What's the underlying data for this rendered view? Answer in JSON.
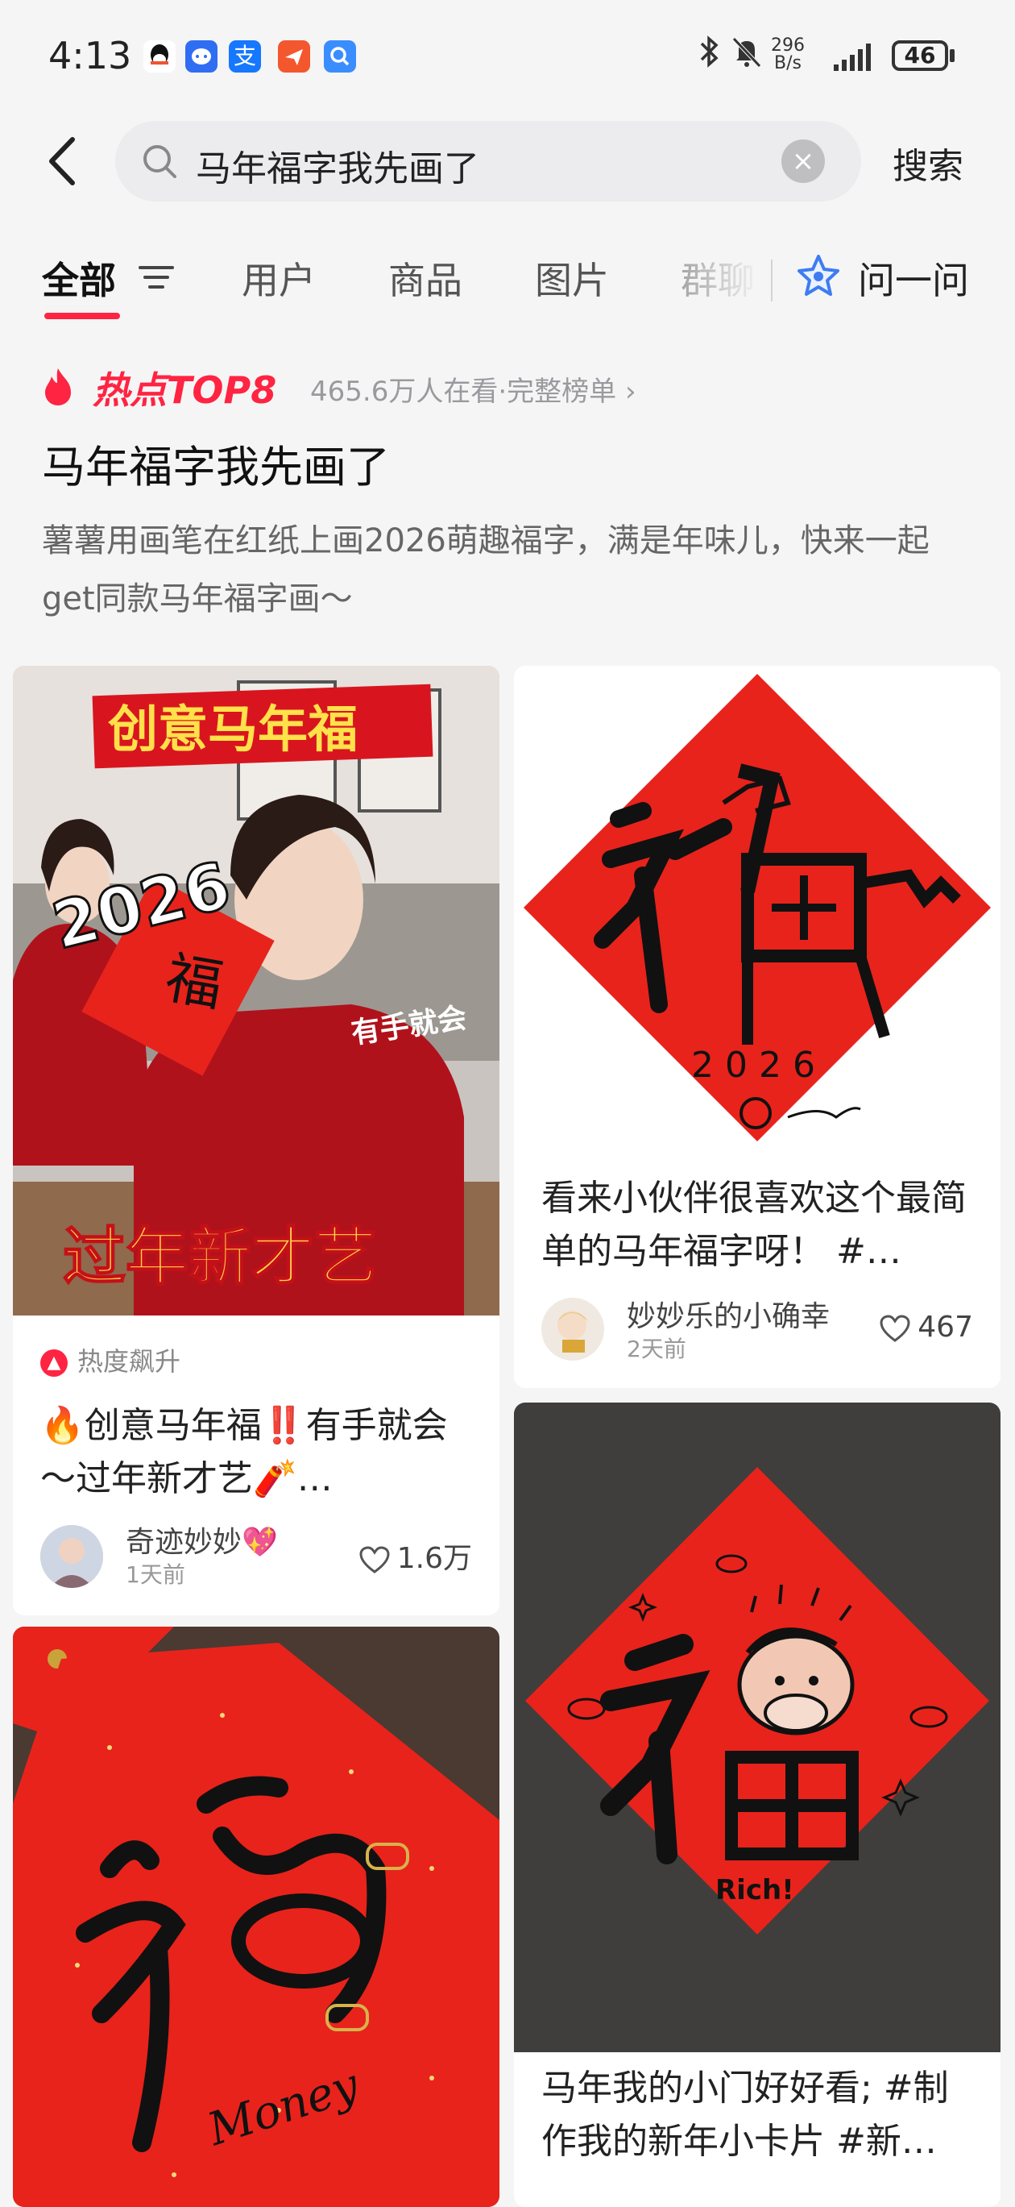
{
  "status_bar": {
    "time": "4:13",
    "app_icons": [
      "qq-icon",
      "chat-bubble-icon",
      "alipay-icon",
      "send-icon",
      "search-app-icon"
    ],
    "net_speed_value": "296",
    "net_speed_unit": "B/s",
    "battery": "46"
  },
  "search": {
    "query": "马年福字我先画了",
    "search_button": "搜索"
  },
  "tabs": {
    "items": [
      "全部",
      "用户",
      "商品",
      "图片",
      "群聊"
    ],
    "active_index": 0,
    "ask_label": "问一问"
  },
  "hot": {
    "label": "热点TOP8",
    "meta": "465.6万人在看·完整榜单",
    "title": "马年福字我先画了",
    "description": "薯薯用画笔在红纸上画2026萌趣福字，满是年味儿，快来一起get同款马年福字画～"
  },
  "cards": {
    "card1": {
      "overlay_top": "创意马年福",
      "overlay_year": "2026",
      "overlay_side": "有手就会",
      "overlay_bottom": "过年新才艺",
      "badge": "热度飙升",
      "title": "🔥创意马年福‼️有手就会～过年新才艺🧨…",
      "author": "奇迹妙妙💖",
      "time": "1天前",
      "likes": "1.6万"
    },
    "card2": {
      "art_year": "2026",
      "title": "看来小伙伴很喜欢这个最简单的马年福字呀！ #…",
      "author": "妙妙乐的小确幸",
      "time": "2天前",
      "likes": "467"
    },
    "card3": {
      "art_text": "Money"
    },
    "card4": {
      "art_text": "Rich!",
      "title": "马年我的小门好好看; #制作我的新年小卡片 #新…"
    }
  },
  "colors": {
    "brand_red": "#ff2442",
    "paper_red": "#e8231b",
    "page_bg": "#f5f5f6"
  }
}
